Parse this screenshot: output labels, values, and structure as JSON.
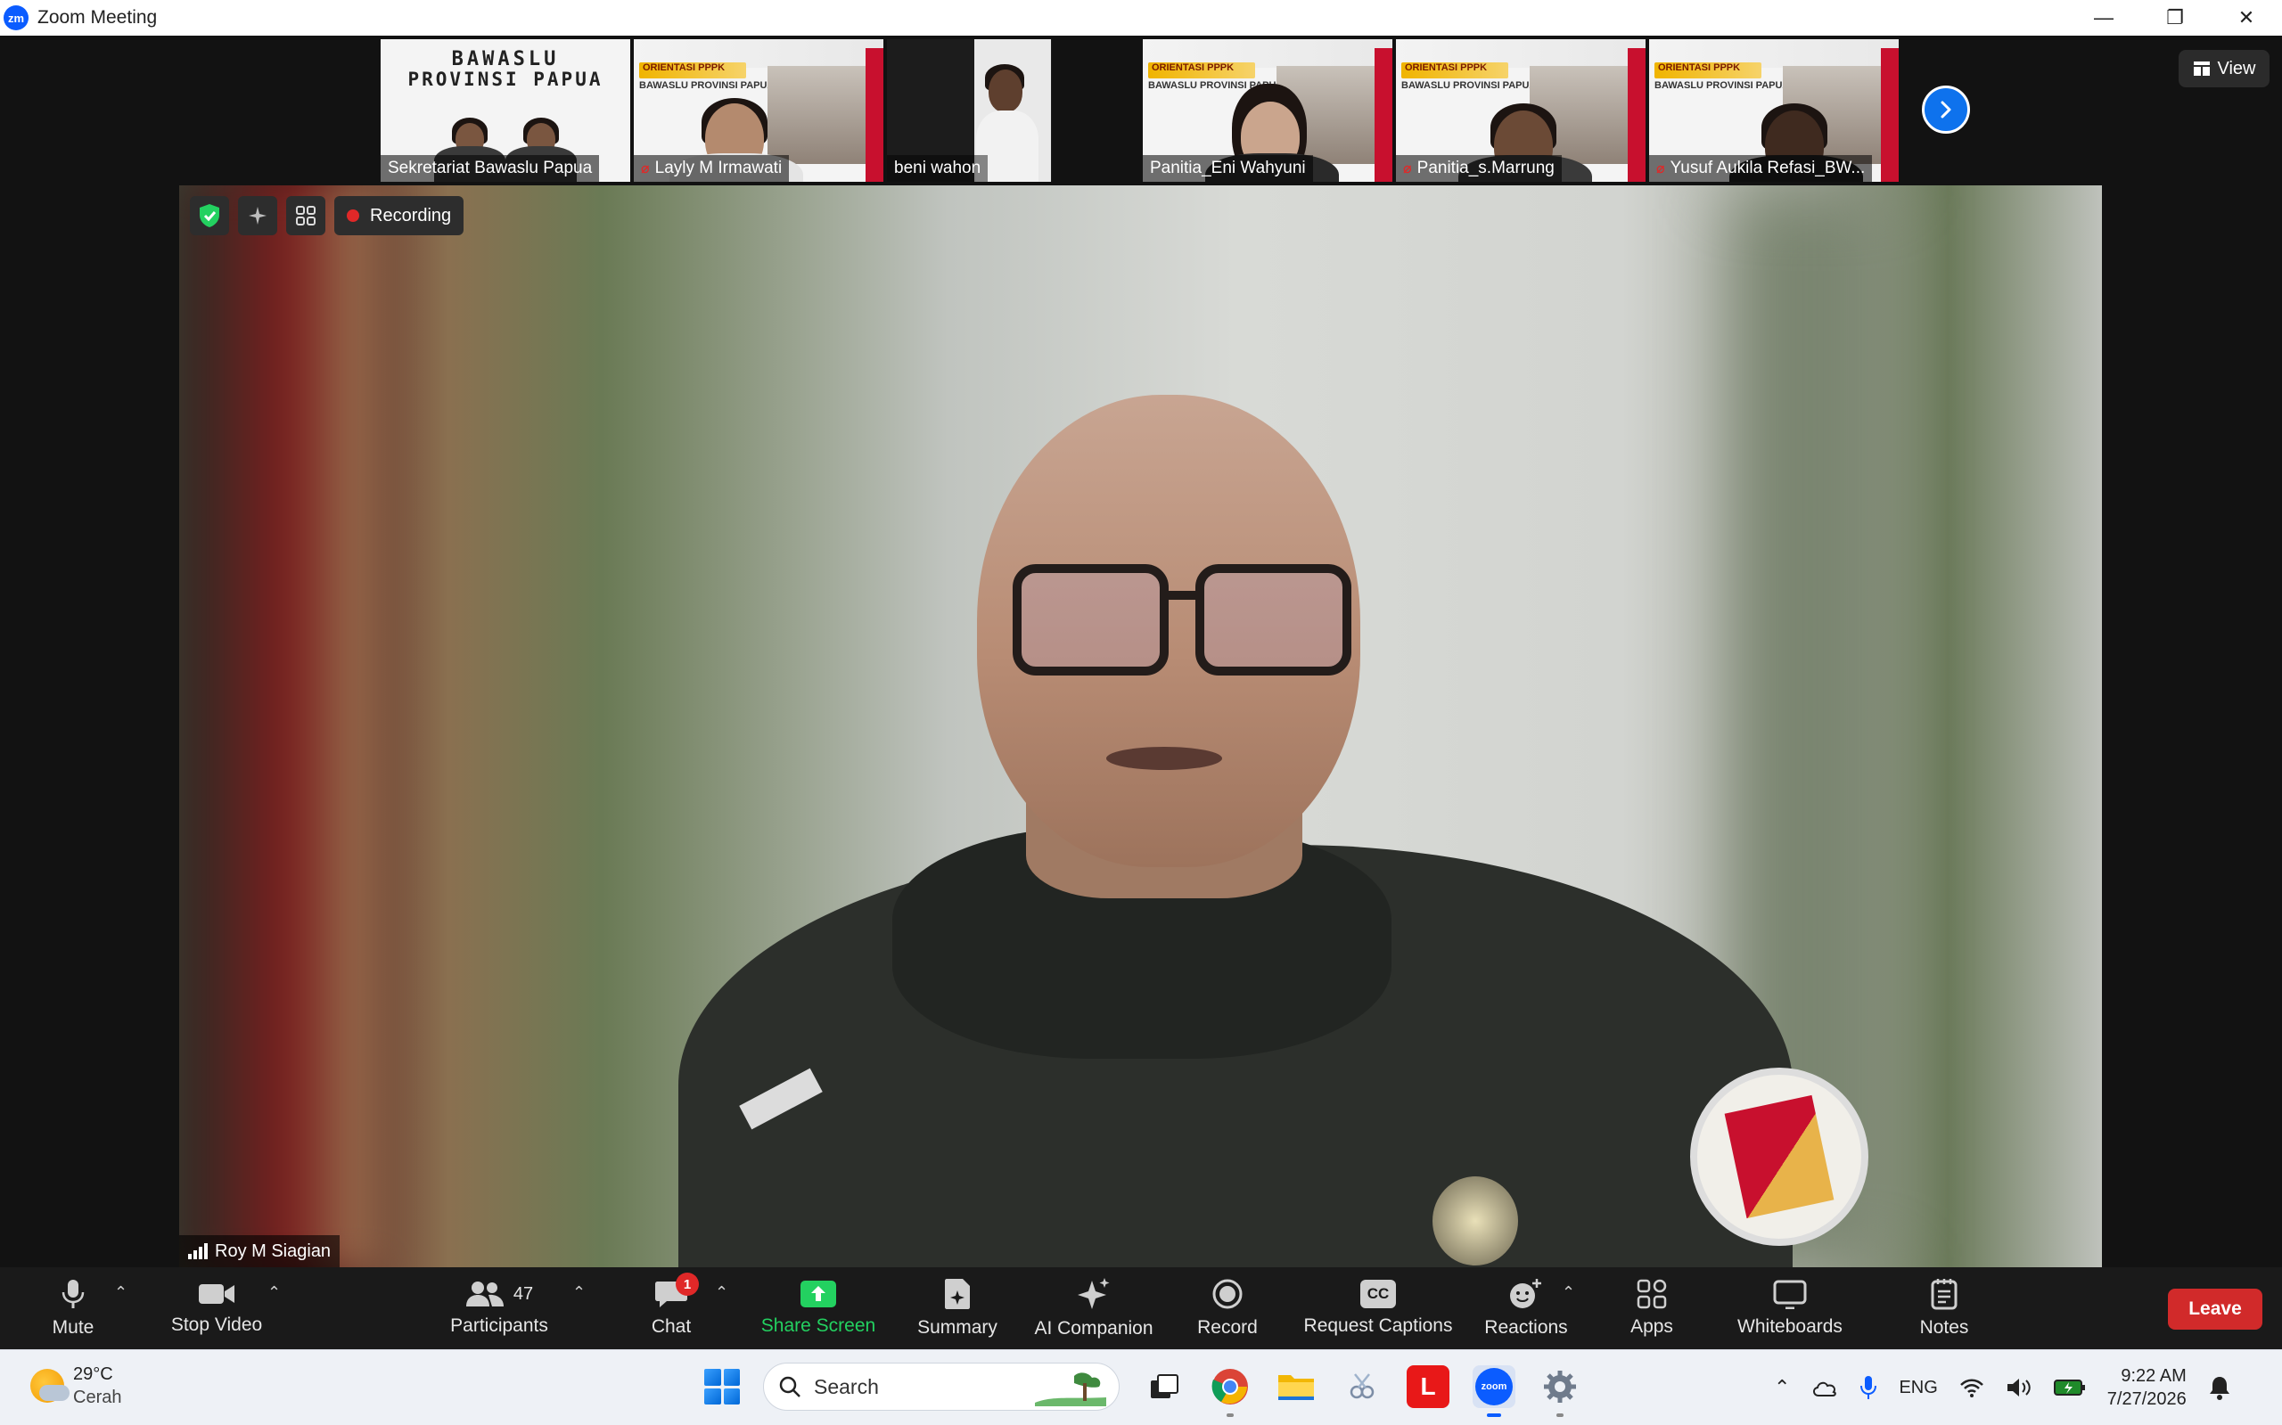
{
  "window": {
    "logo_text": "zm",
    "title": "Zoom Meeting",
    "minimize": "—",
    "restore": "❐",
    "close": "✕"
  },
  "gallery": {
    "tiles": [
      {
        "name": "Sekretariat Bawaslu Papua",
        "muted": false,
        "heading_line1": "BAWASLU",
        "heading_line2": "PROVINSI PAPUA"
      },
      {
        "name": "Layly M Irmawati",
        "muted": true,
        "banner_title": "ORIENTASI PPPK",
        "banner_sub": "BAWASLU PROVINSI PAPUA"
      },
      {
        "name": "beni wahon",
        "muted": false
      },
      {
        "name": "Panitia_Eni Wahyuni",
        "muted": false,
        "banner_title": "ORIENTASI PPPK",
        "banner_sub": "BAWASLU PROVINSI PAPUA"
      },
      {
        "name": "Panitia_s.Marrung",
        "muted": true,
        "banner_title": "ORIENTASI PPPK",
        "banner_sub": "BAWASLU PROVINSI PAPUA"
      },
      {
        "name": "Yusuf Aukila Refasi_BW...",
        "muted": true,
        "banner_title": "ORIENTASI PPPK",
        "banner_sub": "BAWASLU PROVINSI PAPUA"
      }
    ],
    "view_label": "View"
  },
  "main_video": {
    "recording_label": "Recording",
    "speaker_name": "Roy M Siagian"
  },
  "toolbar": {
    "mute": "Mute",
    "stop_video": "Stop Video",
    "participants": "Participants",
    "participants_count": "47",
    "chat": "Chat",
    "chat_badge": "1",
    "share_screen": "Share Screen",
    "summary": "Summary",
    "ai_companion": "AI Companion",
    "record": "Record",
    "request_captions": "Request Captions",
    "captions_icon_text": "CC",
    "reactions": "Reactions",
    "apps": "Apps",
    "whiteboards": "Whiteboards",
    "notes": "Notes",
    "leave": "Leave",
    "colors": {
      "accent": "#0e72ed",
      "share_green": "#23d160",
      "leave_red": "#d12a2a"
    }
  },
  "taskbar": {
    "weather_temp": "29°C",
    "weather_desc": "Cerah",
    "search_label": "Search",
    "lang": "ENG",
    "time": "9:22 AM",
    "date": "7/27/2026",
    "app_l_letter": "L",
    "app_zoom_text": "zoom"
  }
}
